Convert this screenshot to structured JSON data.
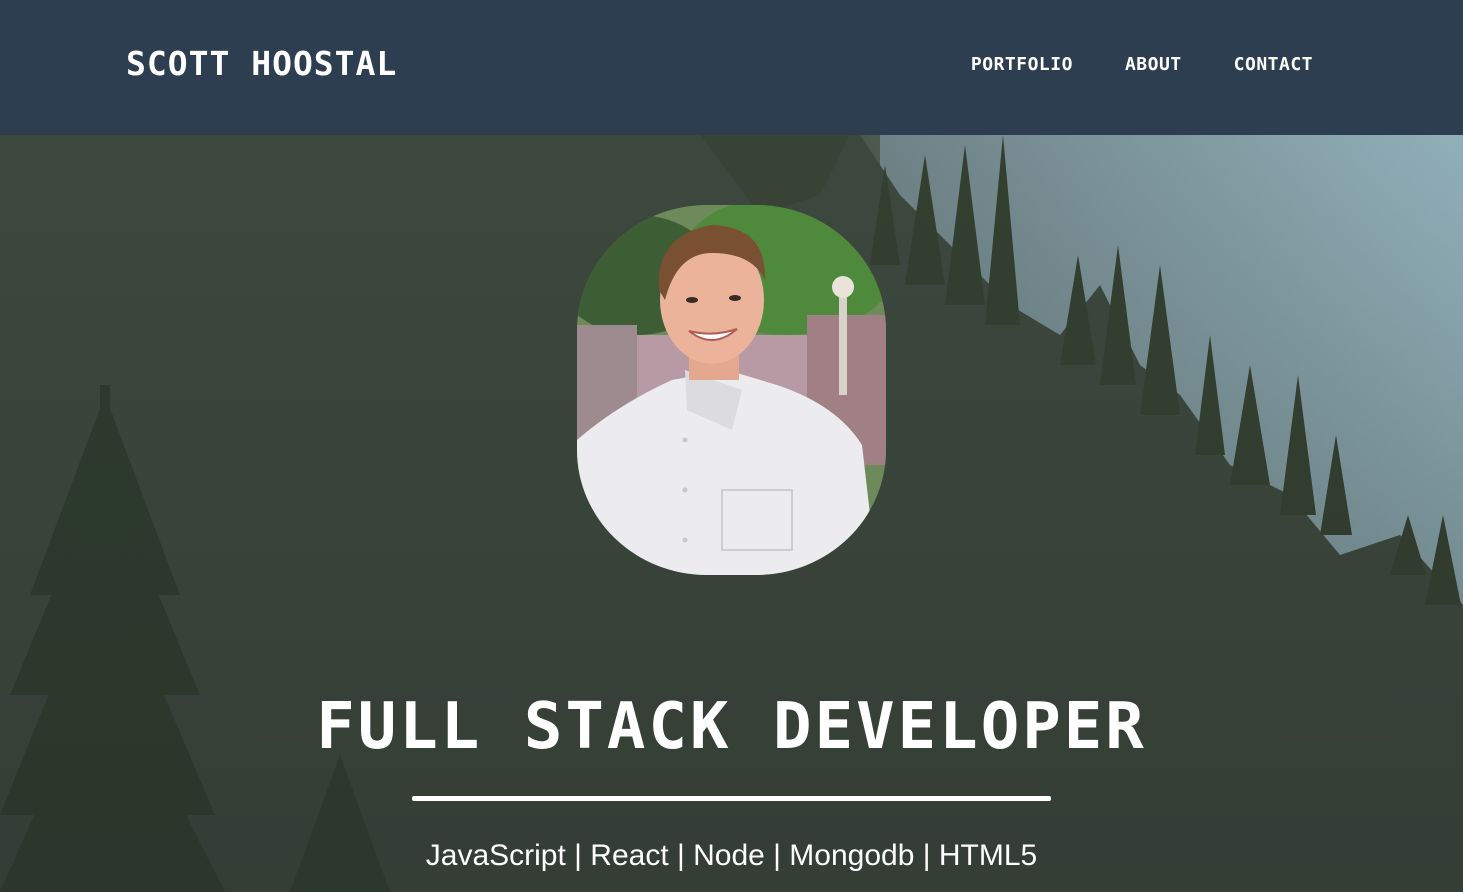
{
  "navbar": {
    "brand": "SCOTT HOOSTAL",
    "links": [
      {
        "label": "PORTFOLIO"
      },
      {
        "label": "ABOUT"
      },
      {
        "label": "CONTACT"
      }
    ],
    "background_color": "#2c3e50"
  },
  "hero": {
    "background_description_icon": "forest-background-image",
    "avatar_icon": "profile-photo",
    "title": "FULL STACK DEVELOPER",
    "skills": "JavaScript | React | Node | Mongodb | HTML5",
    "text_color": "#ffffff"
  }
}
